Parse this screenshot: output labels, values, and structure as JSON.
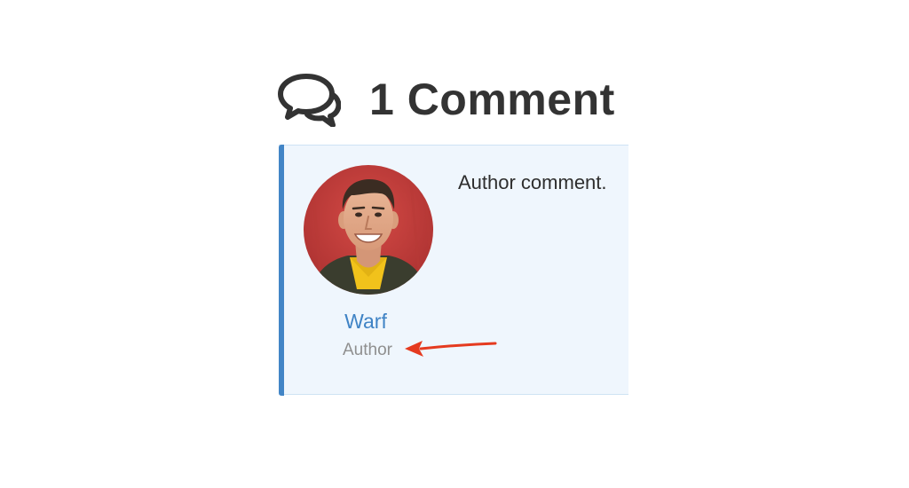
{
  "comments": {
    "icon": "comments-icon",
    "title": "1 Comment"
  },
  "comment": {
    "author_name": "Warf",
    "author_role": "Author",
    "text": "Author comment.",
    "avatar_icon": "avatar-photo",
    "accent_color": "#4285c6",
    "background_color": "#eff6fd"
  },
  "annotation": {
    "icon": "red-arrow-icon",
    "color": "#e53a1f"
  }
}
